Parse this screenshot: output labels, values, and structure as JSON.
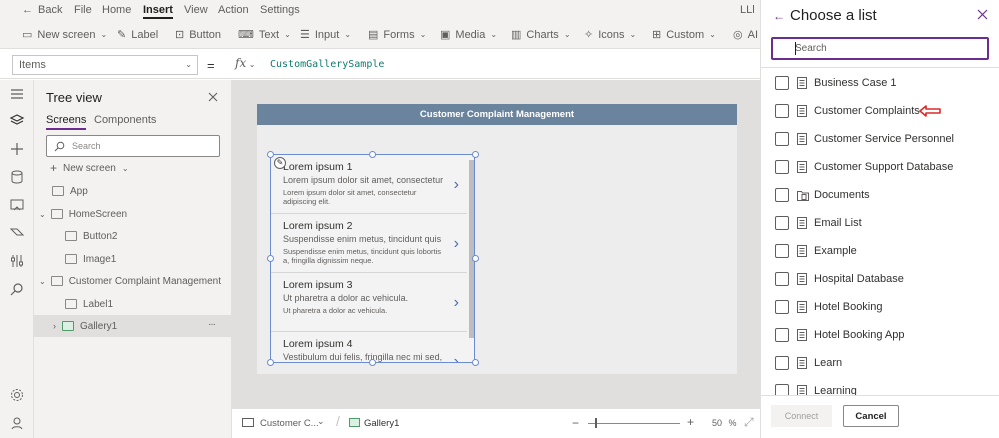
{
  "menu": {
    "back": "Back",
    "items": [
      "File",
      "Home",
      "Insert",
      "View",
      "Action",
      "Settings"
    ],
    "user_initials": "LLl"
  },
  "ribbon": {
    "new_screen": "New screen",
    "label": "Label",
    "button": "Button",
    "text": "Text",
    "input": "Input",
    "forms": "Forms",
    "media": "Media",
    "charts": "Charts",
    "icons": "Icons",
    "custom": "Custom",
    "ai": "AI"
  },
  "formula": {
    "property": "Items",
    "equals": "=",
    "fx": "fx",
    "value": "CustomGallerySample"
  },
  "tree": {
    "title": "Tree view",
    "tabs": [
      "Screens",
      "Components"
    ],
    "search_placeholder": "Search",
    "new_screen": "New screen",
    "nodes": [
      "App",
      "HomeScreen",
      "Button2",
      "Image1",
      "Customer Complaint Management",
      "Label1",
      "Gallery1"
    ],
    "more": "···"
  },
  "canvas": {
    "screen_title": "Customer Complaint Management",
    "gallery_items": [
      {
        "title": "Lorem ipsum 1",
        "subtitle": "Lorem ipsum dolor sit amet, consectetur",
        "body": "Lorem ipsum dolor sit amet, consectetur adipiscing elit."
      },
      {
        "title": "Lorem ipsum 2",
        "subtitle": "Suspendisse enim metus, tincidunt quis",
        "body": "Suspendisse enim metus, tincidunt quis lobortis a, fringilla dignissim neque."
      },
      {
        "title": "Lorem ipsum 3",
        "subtitle": "Ut pharetra a dolor ac vehicula.",
        "body": "Ut pharetra a dolor ac vehicula."
      },
      {
        "title": "Lorem ipsum 4",
        "subtitle": "Vestibulum dui felis, fringilla nec mi sed,",
        "body": ""
      }
    ]
  },
  "statusbar": {
    "screen": "Customer C...",
    "control": "Gallery1",
    "zoom": "50",
    "zoom_unit": "%"
  },
  "panel": {
    "title": "Choose a list",
    "search_placeholder": "Search",
    "lists": [
      "Business Case 1",
      "Customer Complaints",
      "Customer Service Personnel",
      "Customer Support Database",
      "Documents",
      "Email List",
      "Example",
      "Hospital Database",
      "Hotel Booking",
      "Hotel Booking App",
      "Learn",
      "Learning"
    ],
    "connect": "Connect",
    "cancel": "Cancel"
  },
  "colors": {
    "accent": "#6b2d8e",
    "header": "#6a849e",
    "annotation_arrow": "#d92b2b"
  }
}
